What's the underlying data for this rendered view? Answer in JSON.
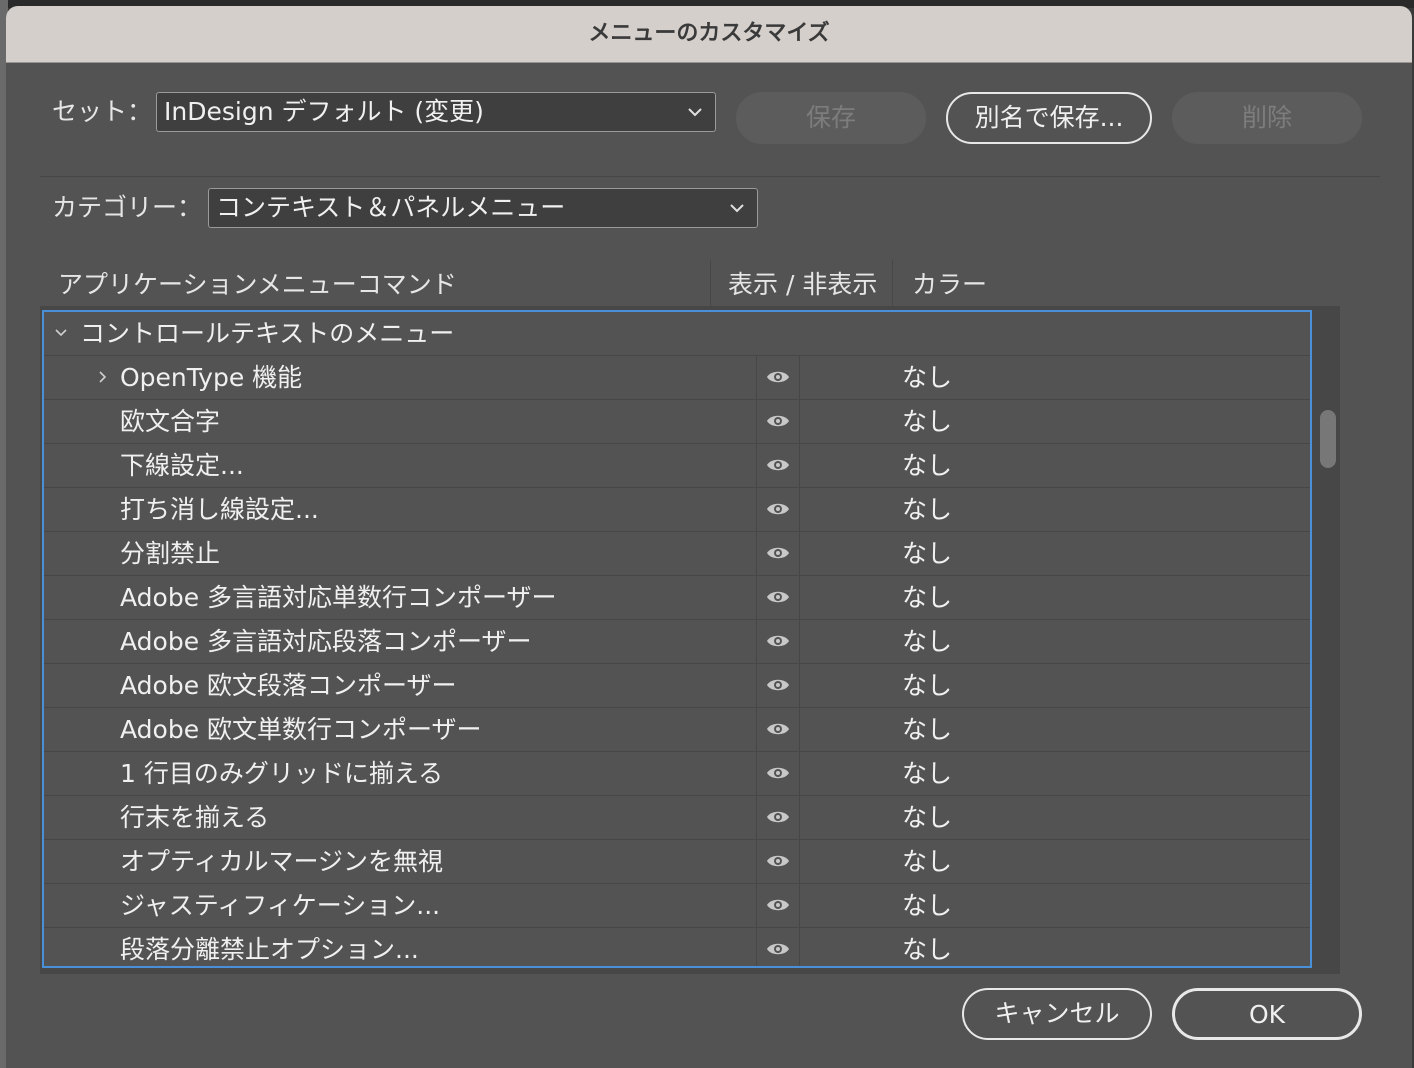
{
  "dialog": {
    "title": "メニューのカスタマイズ",
    "set_label": "セット：",
    "set_value": "InDesign デフォルト (変更)",
    "category_label": "カテゴリー：",
    "category_value": "コンテキスト＆パネルメニュー",
    "buttons": {
      "save": "保存",
      "save_as": "別名で保存...",
      "delete": "削除",
      "cancel": "キャンセル",
      "ok": "OK"
    }
  },
  "table": {
    "headers": [
      "アプリケーションメニューコマンド",
      "表示 / 非表示",
      "カラー"
    ],
    "group": "コントロールテキストのメニュー",
    "rows": [
      {
        "name": "OpenType 機能",
        "color": "なし",
        "expandable": true
      },
      {
        "name": "欧文合字",
        "color": "なし"
      },
      {
        "name": "下線設定...",
        "color": "なし"
      },
      {
        "name": "打ち消し線設定...",
        "color": "なし"
      },
      {
        "name": "分割禁止",
        "color": "なし"
      },
      {
        "name": "Adobe 多言語対応単数行コンポーザー",
        "color": "なし"
      },
      {
        "name": "Adobe 多言語対応段落コンポーザー",
        "color": "なし"
      },
      {
        "name": "Adobe 欧文段落コンポーザー",
        "color": "なし"
      },
      {
        "name": "Adobe 欧文単数行コンポーザー",
        "color": "なし"
      },
      {
        "name": "1 行目のみグリッドに揃える",
        "color": "なし"
      },
      {
        "name": "行末を揃える",
        "color": "なし"
      },
      {
        "name": "オプティカルマージンを無視",
        "color": "なし"
      },
      {
        "name": "ジャスティフィケーション...",
        "color": "なし"
      },
      {
        "name": "段落分離禁止オプション...",
        "color": "なし"
      }
    ]
  },
  "colors": {
    "dialog_bg": "#535353",
    "titlebar_bg": "#d4cfca",
    "selection_border": "#4a90d9"
  },
  "icons": {
    "visibility": "eye-icon",
    "expand_collapsed": "chevron-right-icon",
    "expand_open": "chevron-down-icon",
    "dropdown": "chevron-down-icon"
  }
}
